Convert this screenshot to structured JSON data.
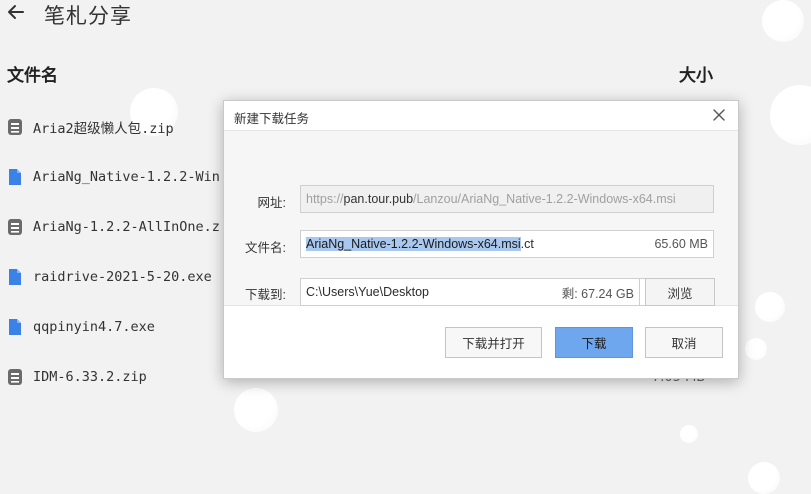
{
  "header": {
    "back_icon": "arrow-left-icon",
    "title": "笔札分享"
  },
  "columns": {
    "name": "文件名",
    "size": "大小"
  },
  "files": [
    {
      "name": "Aria2超级懒人包.zip",
      "icon": "archive-icon",
      "size": ""
    },
    {
      "name": "AriaNg_Native-1.2.2-Win",
      "icon": "document-icon",
      "size": ""
    },
    {
      "name": "AriaNg-1.2.2-AllInOne.z",
      "icon": "archive-icon",
      "size": ""
    },
    {
      "name": "raidrive-2021-5-20.exe",
      "icon": "document-icon",
      "size": ""
    },
    {
      "name": "qqpinyin4.7.exe",
      "icon": "document-icon",
      "size": ""
    },
    {
      "name": "IDM-6.33.2.zip",
      "icon": "archive-icon",
      "size": "7.05 MB"
    }
  ],
  "dialog": {
    "title": "新建下载任务",
    "url_label": "网址:",
    "url_scheme": "https://",
    "url_host": "pan.tour.pub",
    "url_path": "/Lanzou/AriaNg_Native-1.2.2-Windows-x64.msi",
    "filename_label": "文件名:",
    "filename_selected": "AriaNg_Native-1.2.2-Windows-x64.msi",
    "filename_suffix": ".ct",
    "filename_size": "65.60 MB",
    "save_label": "下载到:",
    "save_path": "C:\\Users\\Yue\\Desktop",
    "free_space": "剩: 67.24 GB",
    "browse_label": "浏览",
    "btn_download_open": "下载并打开",
    "btn_download": "下载",
    "btn_cancel": "取消"
  },
  "colors": {
    "primary": "#6fa7ef",
    "selection": "#a9c8ef",
    "archive_icon": "#6b6b6b",
    "document_icon": "#3b82e6"
  }
}
